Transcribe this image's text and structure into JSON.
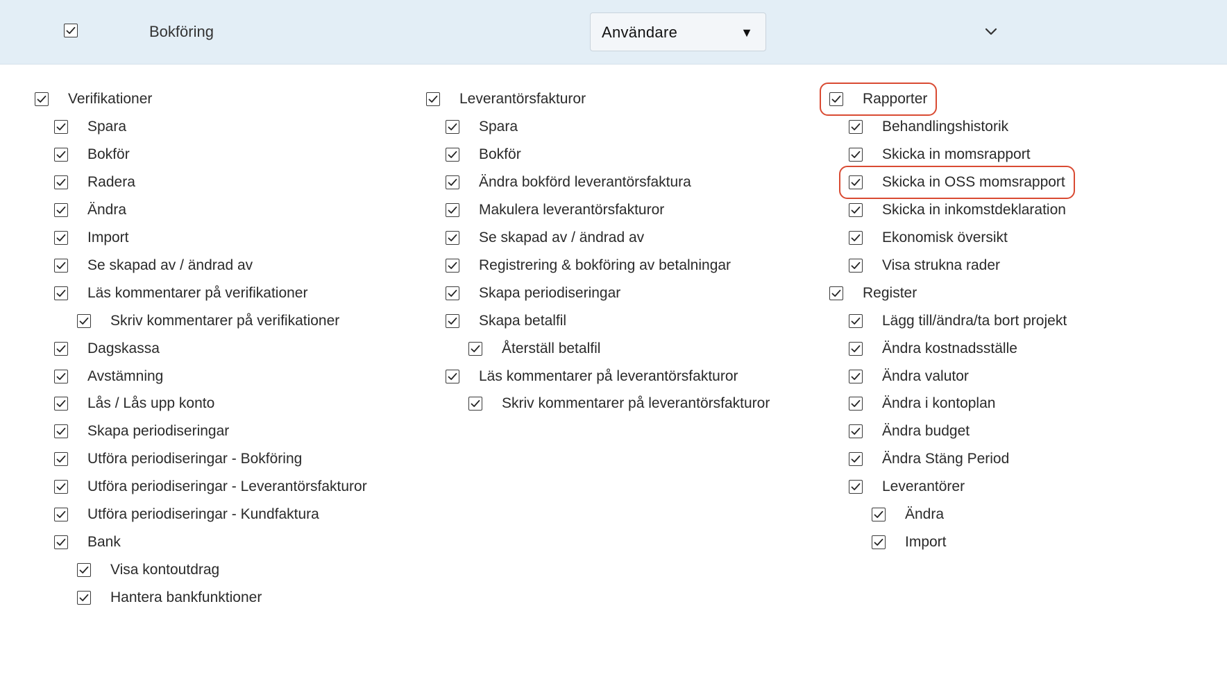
{
  "header": {
    "title": "Bokföring",
    "checked": true,
    "role_select": {
      "value": "Användare",
      "arrow": "▼"
    },
    "expand_icon": "chevron-down-icon"
  },
  "columns": [
    {
      "items": [
        {
          "label": "Verifikationer",
          "level": 0,
          "checked": true
        },
        {
          "label": "Spara",
          "level": 1,
          "checked": true
        },
        {
          "label": "Bokför",
          "level": 1,
          "checked": true
        },
        {
          "label": "Radera",
          "level": 1,
          "checked": true
        },
        {
          "label": "Ändra",
          "level": 1,
          "checked": true
        },
        {
          "label": "Import",
          "level": 1,
          "checked": true
        },
        {
          "label": "Se skapad av / ändrad av",
          "level": 1,
          "checked": true
        },
        {
          "label": "Läs kommentarer på verifikationer",
          "level": 1,
          "checked": true
        },
        {
          "label": "Skriv kommentarer på verifikationer",
          "level": 2,
          "checked": true
        },
        {
          "label": "Dagskassa",
          "level": 1,
          "checked": true
        },
        {
          "label": "Avstämning",
          "level": 1,
          "checked": true
        },
        {
          "label": "Lås / Lås upp konto",
          "level": 1,
          "checked": true
        },
        {
          "label": "Skapa periodiseringar",
          "level": 1,
          "checked": true
        },
        {
          "label": "Utföra periodiseringar - Bokföring",
          "level": 1,
          "checked": true
        },
        {
          "label": "Utföra periodiseringar - Leverantörsfakturor",
          "level": 1,
          "checked": true
        },
        {
          "label": "Utföra periodiseringar - Kundfaktura",
          "level": 1,
          "checked": true
        },
        {
          "label": "Bank",
          "level": 1,
          "checked": true
        },
        {
          "label": "Visa kontoutdrag",
          "level": 2,
          "checked": true
        },
        {
          "label": "Hantera bankfunktioner",
          "level": 2,
          "checked": true
        }
      ]
    },
    {
      "items": [
        {
          "label": "Leverantörsfakturor",
          "level": 0,
          "checked": true
        },
        {
          "label": "Spara",
          "level": 1,
          "checked": true
        },
        {
          "label": "Bokför",
          "level": 1,
          "checked": true
        },
        {
          "label": "Ändra bokförd leverantörsfaktura",
          "level": 1,
          "checked": true
        },
        {
          "label": "Makulera leverantörsfakturor",
          "level": 1,
          "checked": true
        },
        {
          "label": "Se skapad av / ändrad av",
          "level": 1,
          "checked": true
        },
        {
          "label": "Registrering & bokföring av betalningar",
          "level": 1,
          "checked": true
        },
        {
          "label": "Skapa periodiseringar",
          "level": 1,
          "checked": true
        },
        {
          "label": "Skapa betalfil",
          "level": 1,
          "checked": true
        },
        {
          "label": "Återställ betalfil",
          "level": 2,
          "checked": true
        },
        {
          "label": "Läs kommentarer på leverantörsfakturor",
          "level": 1,
          "checked": true
        },
        {
          "label": "Skriv kommentarer på leverantörsfakturor",
          "level": 2,
          "checked": true
        }
      ]
    },
    {
      "items": [
        {
          "label": "Rapporter",
          "level": 0,
          "checked": true,
          "highlighted": true
        },
        {
          "label": "Behandlingshistorik",
          "level": 1,
          "checked": true
        },
        {
          "label": "Skicka in momsrapport",
          "level": 1,
          "checked": true
        },
        {
          "label": "Skicka in OSS momsrapport",
          "level": 1,
          "checked": true,
          "highlighted": true
        },
        {
          "label": "Skicka in inkomstdeklaration",
          "level": 1,
          "checked": true
        },
        {
          "label": "Ekonomisk översikt",
          "level": 1,
          "checked": true
        },
        {
          "label": "Visa strukna rader",
          "level": 1,
          "checked": true
        },
        {
          "label": "Register",
          "level": 0,
          "checked": true
        },
        {
          "label": "Lägg till/ändra/ta bort projekt",
          "level": 1,
          "checked": true
        },
        {
          "label": "Ändra kostnadsställe",
          "level": 1,
          "checked": true
        },
        {
          "label": "Ändra valutor",
          "level": 1,
          "checked": true
        },
        {
          "label": "Ändra i kontoplan",
          "level": 1,
          "checked": true
        },
        {
          "label": "Ändra budget",
          "level": 1,
          "checked": true
        },
        {
          "label": "Ändra Stäng Period",
          "level": 1,
          "checked": true
        },
        {
          "label": "Leverantörer",
          "level": 1,
          "checked": true
        },
        {
          "label": "Ändra",
          "level": 2,
          "checked": true
        },
        {
          "label": "Import",
          "level": 2,
          "checked": true
        }
      ]
    }
  ],
  "colors": {
    "header_bg": "#e3eef6",
    "highlight": "#d94a32",
    "checkbox_border": "#3a3a3a"
  }
}
